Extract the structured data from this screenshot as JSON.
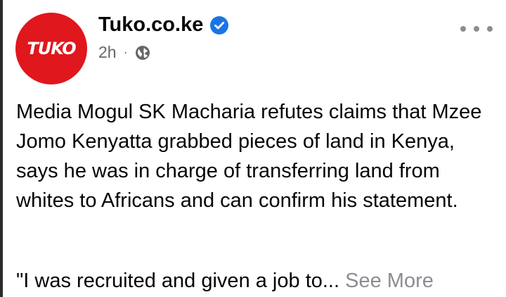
{
  "post": {
    "author": "Tuko.co.ke",
    "logo_text": "TUKO",
    "time": "2h",
    "separator": "·",
    "paragraphs": [
      "Media Mogul SK Macharia refutes claims that Mzee Jomo Kenyatta grabbed pieces of land in Kenya, says he was in charge of transferring land from whites to Africans and can confirm his statement."
    ],
    "truncated_line": "\"I was recruited and given a job to...",
    "see_more": "See More"
  },
  "icons": {
    "verified": "verified-badge-icon",
    "privacy": "globe-icon",
    "menu": "more-dots-icon"
  },
  "colors": {
    "brand": "#e0171d",
    "verified": "#1b74e4",
    "secondary_text": "#65676b",
    "see_more": "#8a8d91"
  }
}
